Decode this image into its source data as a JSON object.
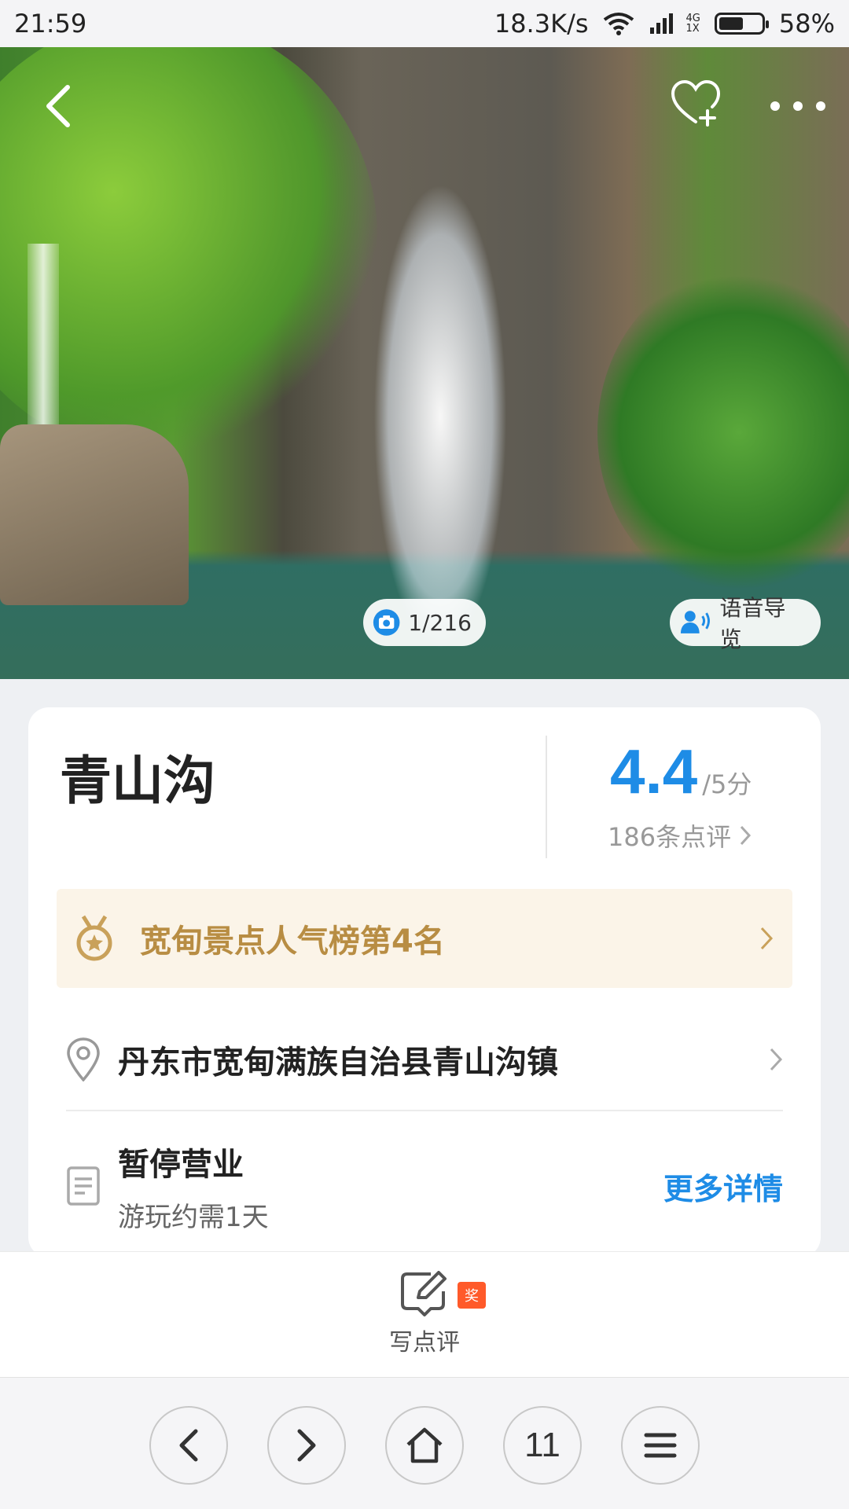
{
  "status_bar": {
    "time": "21:59",
    "speed": "18.3K/s",
    "network_top": "4G",
    "network_bottom": "1X",
    "battery": "58%",
    "battery_level": 0.58
  },
  "hero": {
    "photo_counter": "1/216",
    "audio_guide": "语音导览"
  },
  "attraction": {
    "name": "青山沟",
    "score": "4.4",
    "score_unit": "/5分",
    "reviews": "186条点评",
    "rank": "宽甸景点人气榜第4名",
    "address": "丹东市宽甸满族自治县青山沟镇",
    "status": "暂停营业",
    "duration": "游玩约需1天",
    "more_details": "更多详情"
  },
  "action_bar": {
    "write_review": "写点评",
    "badge": "奖"
  },
  "nav_bar": {
    "tabs_count": "11"
  },
  "colors": {
    "accent_blue": "#1e8ce6",
    "rank_gold": "#b88d43",
    "badge_orange": "#ff5a2a"
  }
}
